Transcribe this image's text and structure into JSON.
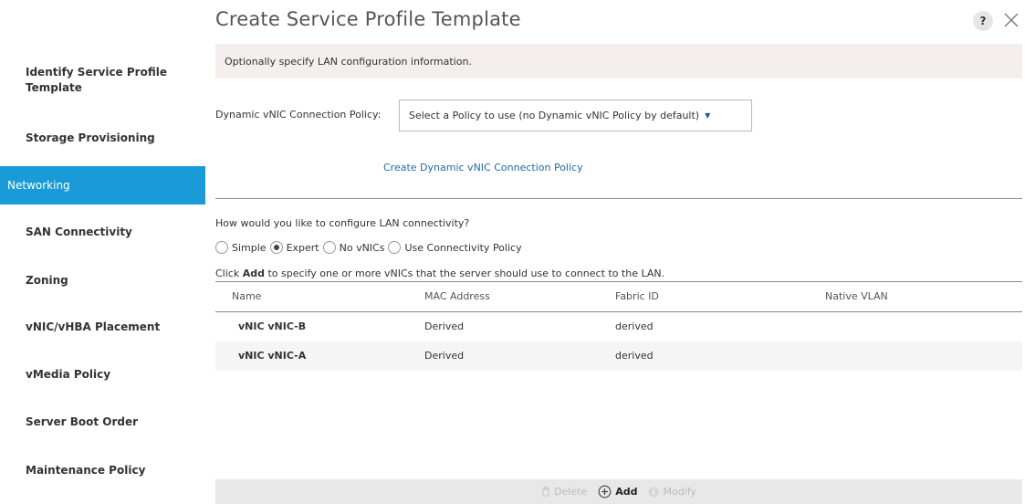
{
  "sidebar": {
    "items": [
      {
        "label": "Identify Service Profile Template",
        "active": false
      },
      {
        "label": "Storage Provisioning",
        "active": false
      },
      {
        "label": "Networking",
        "active": true
      },
      {
        "label": "SAN Connectivity",
        "active": false
      },
      {
        "label": "Zoning",
        "active": false
      },
      {
        "label": "vNIC/vHBA Placement",
        "active": false
      },
      {
        "label": "vMedia Policy",
        "active": false
      },
      {
        "label": "Server Boot Order",
        "active": false
      },
      {
        "label": "Maintenance Policy",
        "active": false
      }
    ]
  },
  "header": {
    "title": "Create Service Profile Template",
    "help_label": "?"
  },
  "banner": {
    "text": "Optionally specify LAN configuration information."
  },
  "policy": {
    "label": "Dynamic vNIC Connection Policy:",
    "selected": "Select a Policy to use (no Dynamic vNIC Policy by default)",
    "create_link": "Create Dynamic vNIC Connection Policy"
  },
  "lan": {
    "question": "How would you like to configure LAN connectivity?",
    "options": [
      {
        "label": "Simple",
        "checked": false
      },
      {
        "label": "Expert",
        "checked": true
      },
      {
        "label": "No vNICs",
        "checked": false
      },
      {
        "label": "Use Connectivity Policy",
        "checked": false
      }
    ],
    "hint_prefix": "Click ",
    "hint_bold": "Add",
    "hint_suffix": " to specify one or more vNICs that the server should use to connect to the LAN."
  },
  "table": {
    "columns": [
      "Name",
      "MAC Address",
      "Fabric ID",
      "Native VLAN"
    ],
    "rows": [
      {
        "name": "vNIC vNIC-B",
        "mac": "Derived",
        "fabric": "derived",
        "vlan": ""
      },
      {
        "name": "vNIC vNIC-A",
        "mac": "Derived",
        "fabric": "derived",
        "vlan": ""
      }
    ]
  },
  "footer": {
    "delete_label": "Delete",
    "add_label": "Add",
    "modify_label": "Modify"
  },
  "colors": {
    "accent": "#1a9bd7",
    "link": "#1e6aa3",
    "banner_bg": "#f4eeef"
  },
  "icons": {
    "help": "question-icon",
    "close": "close-icon",
    "delete": "trash-icon",
    "add": "plus-circle-icon",
    "modify": "info-icon"
  }
}
